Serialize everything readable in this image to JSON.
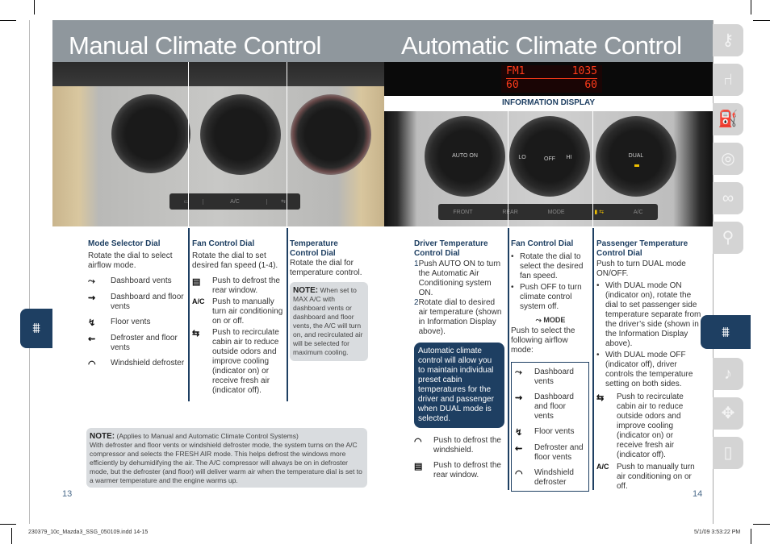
{
  "left_page": {
    "title": "Manual Climate Control",
    "photo_buttons": {
      "rear_defrost": "▭",
      "ac": "A/C",
      "recirc": "⇆"
    },
    "mode_dial": {
      "heading": "Mode Selector Dial",
      "desc": "Rotate the dial to select airflow mode.",
      "items": [
        {
          "icon": "dashboard-vents-icon",
          "label": "Dashboard vents"
        },
        {
          "icon": "dashboard-floor-vents-icon",
          "label": "Dashboard and floor vents"
        },
        {
          "icon": "floor-vents-icon",
          "label": "Floor vents"
        },
        {
          "icon": "defroster-floor-vents-icon",
          "label": "Defroster and floor vents"
        },
        {
          "icon": "windshield-defroster-icon",
          "label": "Windshield defroster"
        }
      ]
    },
    "fan_dial": {
      "heading": "Fan Control Dial",
      "desc": "Rotate the dial to set desired fan speed (1-4).",
      "items": [
        {
          "icon": "rear-defrost-icon",
          "label": "Push to defrost the rear window."
        },
        {
          "icon": "ac-icon",
          "icon_text": "A/C",
          "label": "Push to manually turn air conditioning on or off."
        },
        {
          "icon": "recirculate-icon",
          "label": "Push to recirculate cabin air to reduce outside odors and improve cooling (indicator on) or receive fresh air (indicator off)."
        }
      ]
    },
    "temp_dial": {
      "heading": "Temperature Control Dial",
      "desc": "Rotate the dial for temperature control.",
      "note_label": "NOTE:",
      "note": "When set to MAX A/C with dashboard vents or dashboard and floor vents, the A/C will turn on, and recirculated air will be selected for maximum cooling."
    },
    "bottom_note": {
      "label": "NOTE:",
      "subtitle": "(Applies to Manual and Automatic Climate Control Systems)",
      "text": "With defroster and floor vents or windshield defroster mode, the system turns on the A/C compressor and selects the FRESH AIR mode. This helps defrost the windows more efficiently by dehumidifying the air. The A/C compressor will always be on in defroster mode, but the defroster (and floor) will deliver warm air when the temperature dial is set to a warmer temperature and the engine warms up."
    },
    "page_number": "13"
  },
  "right_page": {
    "title": "Automatic Climate Control",
    "lcd": {
      "line1_left": "FM1",
      "line1_right": "1035",
      "line2_left": "60",
      "line2_right": "60"
    },
    "info_display_label": "INFORMATION DISPLAY",
    "knobs": {
      "driver": "AUTO ON",
      "fan": "OFF",
      "fan_lo": "LO",
      "fan_hi": "HI",
      "passenger": "DUAL"
    },
    "photo_buttons": {
      "front": "FRONT",
      "rear": "REAR",
      "mode": "MODE",
      "ac": "A/C"
    },
    "driver_dial": {
      "heading": "Driver Temperature Control Dial",
      "steps": [
        {
          "num": "1",
          "text": "Push AUTO ON to turn the Automatic Air Conditioning system ON."
        },
        {
          "num": "2",
          "text": "Rotate dial to desired air temperature (shown in Information Display above)."
        }
      ],
      "callout": "Automatic climate control will allow you to maintain individual preset cabin temperatures for the driver and passenger when DUAL mode is selected.",
      "items": [
        {
          "icon": "windshield-defroster-icon",
          "label": "Push to defrost the windshield."
        },
        {
          "icon": "rear-defrost-icon",
          "label": "Push to defrost the rear window."
        }
      ]
    },
    "fan_dial": {
      "heading": "Fan Control Dial",
      "bullets": [
        "Rotate the dial to select the desired fan speed.",
        "Push OFF to turn climate control system off."
      ],
      "mode_label": "MODE",
      "mode_desc": "Push to select the following airflow mode:",
      "modes": [
        {
          "icon": "dashboard-vents-icon",
          "label": "Dashboard vents"
        },
        {
          "icon": "dashboard-floor-vents-icon",
          "label": "Dashboard and floor vents"
        },
        {
          "icon": "floor-vents-icon",
          "label": "Floor vents"
        },
        {
          "icon": "defroster-floor-vents-icon",
          "label": "Defroster and floor vents"
        },
        {
          "icon": "windshield-defroster-icon",
          "label": "Windshield defroster"
        }
      ]
    },
    "passenger_dial": {
      "heading": "Passenger Temperature Control Dial",
      "desc": "Push to turn DUAL mode ON/OFF.",
      "bullets": [
        "With DUAL mode ON (indicator on), rotate the dial to set passenger side temperature separate from the driver’s side (shown in the Information Display above).",
        "With DUAL mode OFF (indicator off), driver controls the temperature setting on both sides."
      ],
      "items": [
        {
          "icon": "recirculate-icon",
          "label": "Push to recirculate cabin air to reduce outside odors and improve cooling (indicator on) or receive fresh air (indicator off)."
        },
        {
          "icon": "ac-icon",
          "icon_text": "A/C",
          "label": "Push to manually turn air conditioning on or off."
        }
      ]
    },
    "page_number": "14"
  },
  "side_tabs": [
    "key-icon",
    "seat-icon",
    "fuel-pump-icon",
    "steering-wheel-icon",
    "gauges-icon",
    "magnifier-icon",
    "climate-icon",
    "music-note-icon",
    "navigation-icon",
    "phone-icon"
  ],
  "active_tab": "climate-icon",
  "slug": {
    "left": "230379_10c_Mazda3_SSG_050109.indd   14-15",
    "right": "5/1/09   3:53:22 PM"
  },
  "colors": {
    "brand_blue": "#1e3f62",
    "header_gray": "#8f979d",
    "note_gray": "#d9dcdf",
    "tab_gray": "#d4d4d4"
  }
}
